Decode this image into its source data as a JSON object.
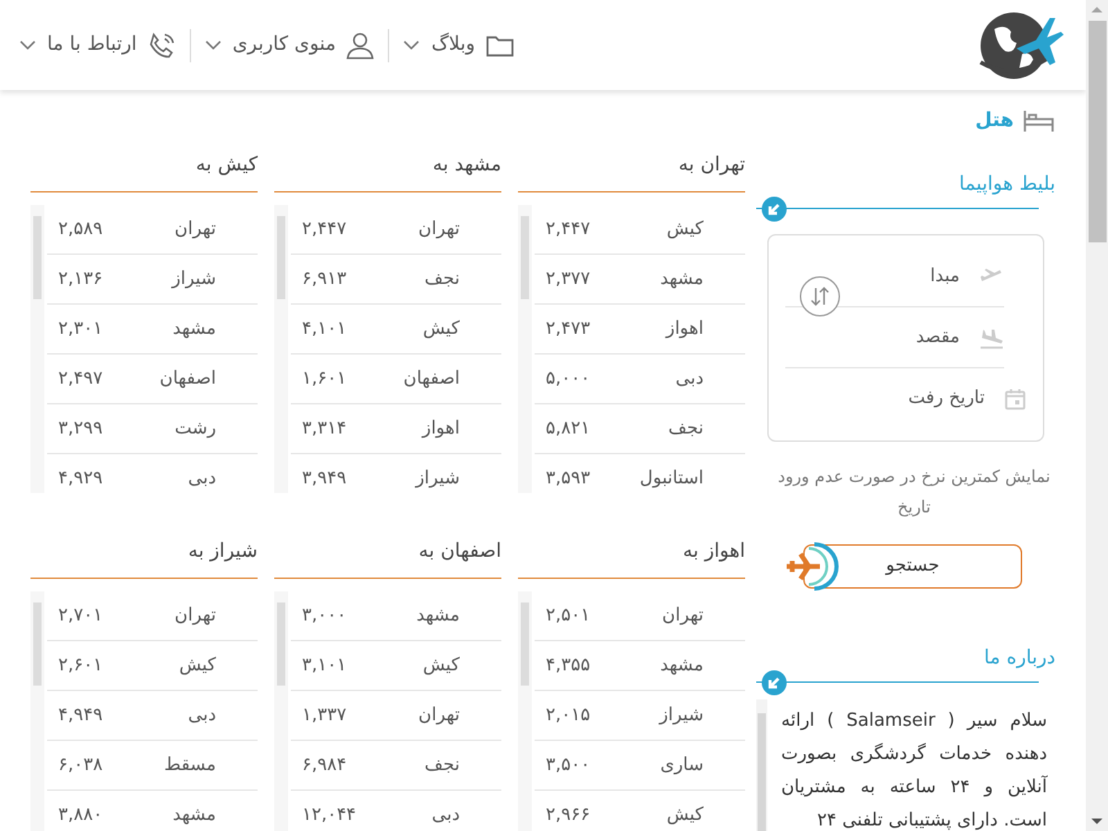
{
  "nav": [
    {
      "label": "وبلاگ",
      "kind": "folder"
    },
    {
      "label": "منوی کاربری",
      "kind": "user"
    },
    {
      "label": "ارتباط با ما",
      "kind": "phone"
    }
  ],
  "tab": {
    "label": "هتل",
    "selected": true
  },
  "flight": {
    "title": "بلیط هواپیما",
    "fields": [
      {
        "label": "مبدا",
        "kind": "takeoff"
      },
      {
        "label": "مقصد",
        "kind": "landing"
      },
      {
        "label": "تاریخ رفت",
        "kind": "date"
      }
    ],
    "note": "نمایش کمترین نرخ در صورت عدم ورود تاریخ",
    "search": "جستجو"
  },
  "tables": [
    {
      "title": "تهران به",
      "rows": [
        [
          "کیش",
          "۲,۴۴۷"
        ],
        [
          "مشهد",
          "۲,۳۷۷"
        ],
        [
          "اهواز",
          "۲,۴۷۳"
        ],
        [
          "دبی",
          "۵,۰۰۰"
        ],
        [
          "نجف",
          "۵,۸۲۱"
        ],
        [
          "استانبول",
          "۳,۵۹۳"
        ]
      ]
    },
    {
      "title": "مشهد به",
      "rows": [
        [
          "تهران",
          "۲,۴۴۷"
        ],
        [
          "نجف",
          "۶,۹۱۳"
        ],
        [
          "کیش",
          "۴,۱۰۱"
        ],
        [
          "اصفهان",
          "۱,۶۰۱"
        ],
        [
          "اهواز",
          "۳,۳۱۴"
        ],
        [
          "شیراز",
          "۳,۹۴۹"
        ]
      ]
    },
    {
      "title": "کیش به",
      "rows": [
        [
          "تهران",
          "۲,۵۸۹"
        ],
        [
          "شیراز",
          "۲,۱۳۶"
        ],
        [
          "مشهد",
          "۲,۳۰۱"
        ],
        [
          "اصفهان",
          "۲,۴۹۷"
        ],
        [
          "رشت",
          "۳,۲۹۹"
        ],
        [
          "دبی",
          "۴,۹۲۹"
        ]
      ]
    },
    {
      "title": "اهواز به",
      "rows": [
        [
          "تهران",
          "۲,۵۰۱"
        ],
        [
          "مشهد",
          "۴,۳۵۵"
        ],
        [
          "شیراز",
          "۲,۰۱۵"
        ],
        [
          "ساری",
          "۳,۵۰۰"
        ],
        [
          "کیش",
          "۲,۹۶۶"
        ]
      ]
    },
    {
      "title": "اصفهان به",
      "rows": [
        [
          "مشهد",
          "۳,۰۰۰"
        ],
        [
          "کیش",
          "۳,۱۰۱"
        ],
        [
          "تهران",
          "۱,۳۳۷"
        ],
        [
          "نجف",
          "۶,۹۸۴"
        ],
        [
          "دبی",
          "۱۲,۰۴۴"
        ]
      ]
    },
    {
      "title": "شیراز به",
      "rows": [
        [
          "تهران",
          "۲,۷۰۱"
        ],
        [
          "کیش",
          "۲,۶۰۱"
        ],
        [
          "دبی",
          "۴,۹۴۹"
        ],
        [
          "مسقط",
          "۶,۰۳۸"
        ],
        [
          "مشهد",
          "۳,۸۸۰"
        ]
      ]
    }
  ],
  "about": {
    "title": "درباره ما",
    "text": "سلام سیر ( Salamseir ) ارائه دهنده خدمات گردشگری بصورت آنلاین و ۲۴ ساعته به مشتریان است. دارای پشتیبانی تلفنی ۲۴"
  }
}
